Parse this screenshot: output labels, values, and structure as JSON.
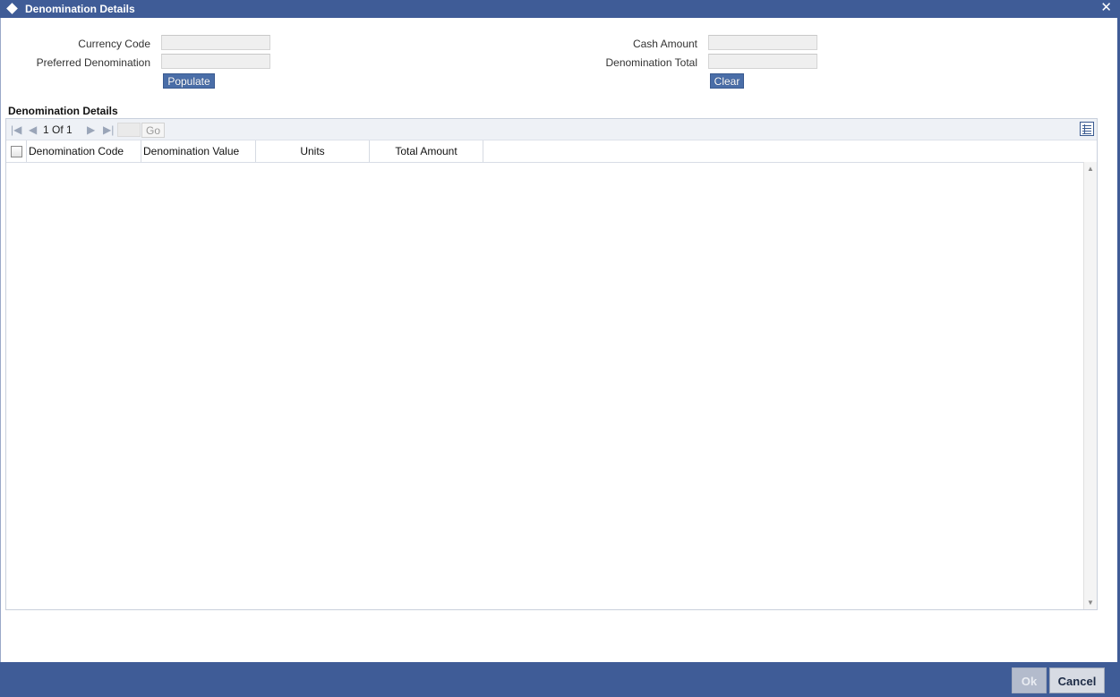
{
  "window": {
    "title": "Denomination Details"
  },
  "form": {
    "currency_code_label": "Currency Code",
    "currency_code_value": "",
    "preferred_denomination_label": "Preferred Denomination",
    "preferred_denomination_value": "",
    "cash_amount_label": "Cash Amount",
    "cash_amount_value": "",
    "denomination_total_label": "Denomination Total",
    "denomination_total_value": "",
    "populate_label": "Populate",
    "clear_label": "Clear"
  },
  "grid": {
    "section_title": "Denomination Details",
    "pager": {
      "current": "1",
      "of": "Of",
      "total": "1",
      "go": "Go"
    },
    "columns": [
      "Denomination Code",
      "Denomination Value",
      "Units",
      "Total Amount"
    ],
    "rows": []
  },
  "footer": {
    "ok_label": "Ok",
    "cancel_label": "Cancel"
  },
  "colors": {
    "titlebar": "#3f5c97",
    "button": "#4a6ea8"
  }
}
